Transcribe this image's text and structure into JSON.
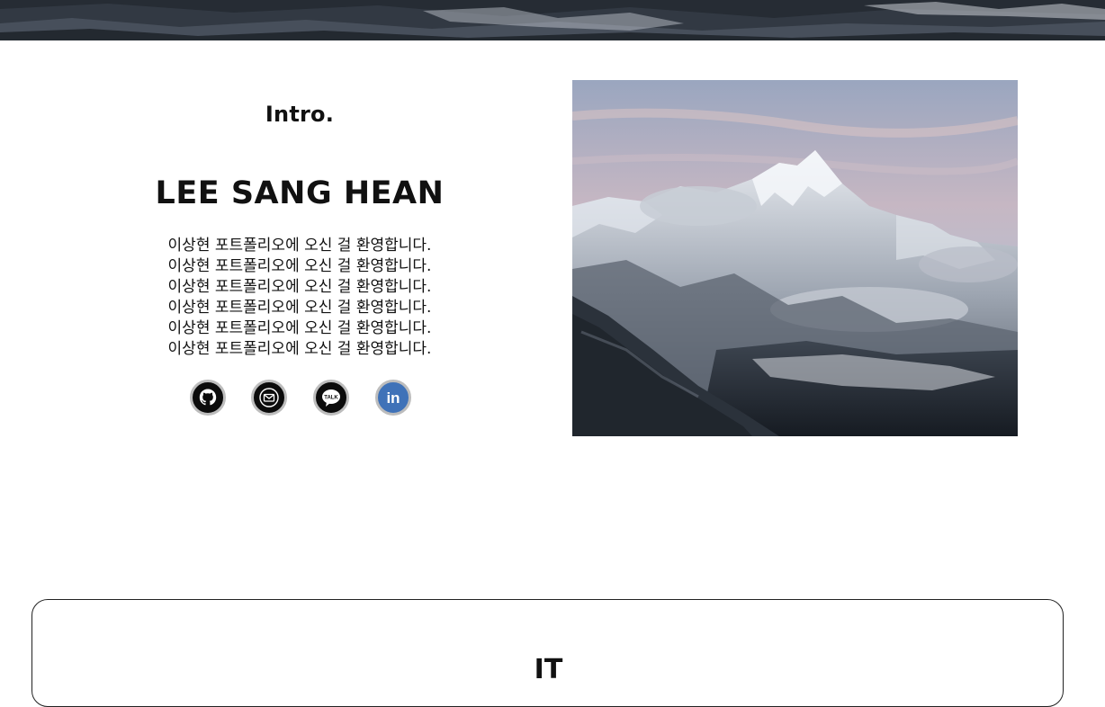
{
  "intro": {
    "heading": "Intro.",
    "name": "LEE SANG HEAN",
    "lines": [
      "이상현 포트폴리오에 오신 걸 환영합니다.",
      "이상현 포트폴리오에 오신 걸 환영합니다.",
      "이상현 포트폴리오에 오신 걸 환영합니다.",
      "이상현 포트폴리오에 오신 걸 환영합니다.",
      "이상현 포트폴리오에 오신 걸 환영합니다.",
      "이상현 포트폴리오에 오신 걸 환영합니다."
    ]
  },
  "social": {
    "items": [
      {
        "icon": "github-icon",
        "color": "#0c0c0c"
      },
      {
        "icon": "mail-icon",
        "color": "#0c0c0c"
      },
      {
        "icon": "kakaotalk-icon",
        "color": "#0c0c0c",
        "badge": "TALK"
      },
      {
        "icon": "linkedin-icon",
        "color": "#3f72b8",
        "badge": "in"
      }
    ]
  },
  "card": {
    "title": "IT"
  }
}
